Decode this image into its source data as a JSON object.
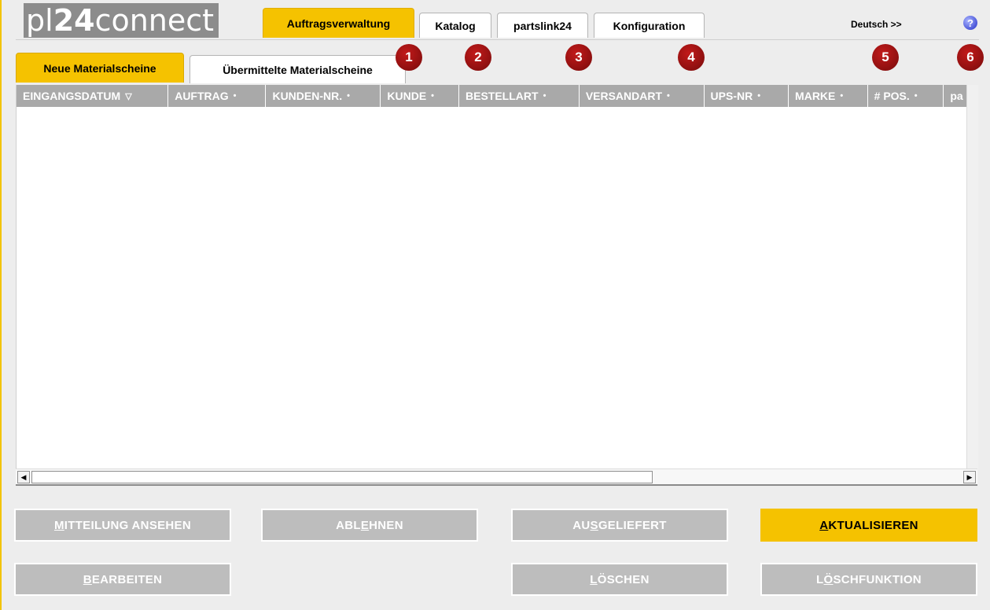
{
  "header": {
    "logo": {
      "part1": "pl",
      "part2": "24",
      "part3": "connect"
    },
    "tabs": [
      {
        "label": "Auftragsverwaltung",
        "active": true
      },
      {
        "label": "Katalog",
        "active": false
      },
      {
        "label": "partslink24",
        "active": false
      },
      {
        "label": "Konfiguration",
        "active": false
      }
    ],
    "language": "Deutsch >>",
    "help": "?"
  },
  "subtabs": [
    {
      "label": "Neue Materialscheine",
      "active": true
    },
    {
      "label": "Übermittelte Materialscheine",
      "active": false
    }
  ],
  "markers": [
    "1",
    "2",
    "3",
    "4",
    "5",
    "6"
  ],
  "table": {
    "columns": [
      {
        "label": "EINGANGSDATUM",
        "sort": "▽"
      },
      {
        "label": "AUFTRAG",
        "sort": "•"
      },
      {
        "label": "KUNDEN-NR.",
        "sort": "•"
      },
      {
        "label": "KUNDE",
        "sort": "•"
      },
      {
        "label": "BESTELLART",
        "sort": "•"
      },
      {
        "label": "VERSANDART",
        "sort": "•"
      },
      {
        "label": "UPS-NR",
        "sort": "•"
      },
      {
        "label": "MARKE",
        "sort": "•"
      },
      {
        "label": "# POS.",
        "sort": "•"
      },
      {
        "label": "pa",
        "sort": ""
      }
    ],
    "rows": []
  },
  "buttons": {
    "mitteilung": {
      "accel": "M",
      "rest": "ITTEILUNG ANSEHEN"
    },
    "ablehnen": {
      "pre": "ABL",
      "accel": "E",
      "post": "HNEN"
    },
    "ausgeliefert": {
      "pre": "AU",
      "accel": "S",
      "post": "GELIEFERT"
    },
    "aktualisieren": {
      "accel": "A",
      "rest": "KTUALISIEREN"
    },
    "bearbeiten": {
      "accel": "B",
      "rest": "EARBEITEN"
    },
    "loeschen": {
      "accel": "L",
      "rest": "ÖSCHEN"
    },
    "loeschfunktion": {
      "pre": "L",
      "accel": "Ö",
      "post": "SCHFUNKTION"
    }
  },
  "colors": {
    "accent": "#f5c200",
    "header_bg": "#a9a9a9",
    "marker": "#a51414",
    "disabled_button": "#bdbdbd"
  }
}
